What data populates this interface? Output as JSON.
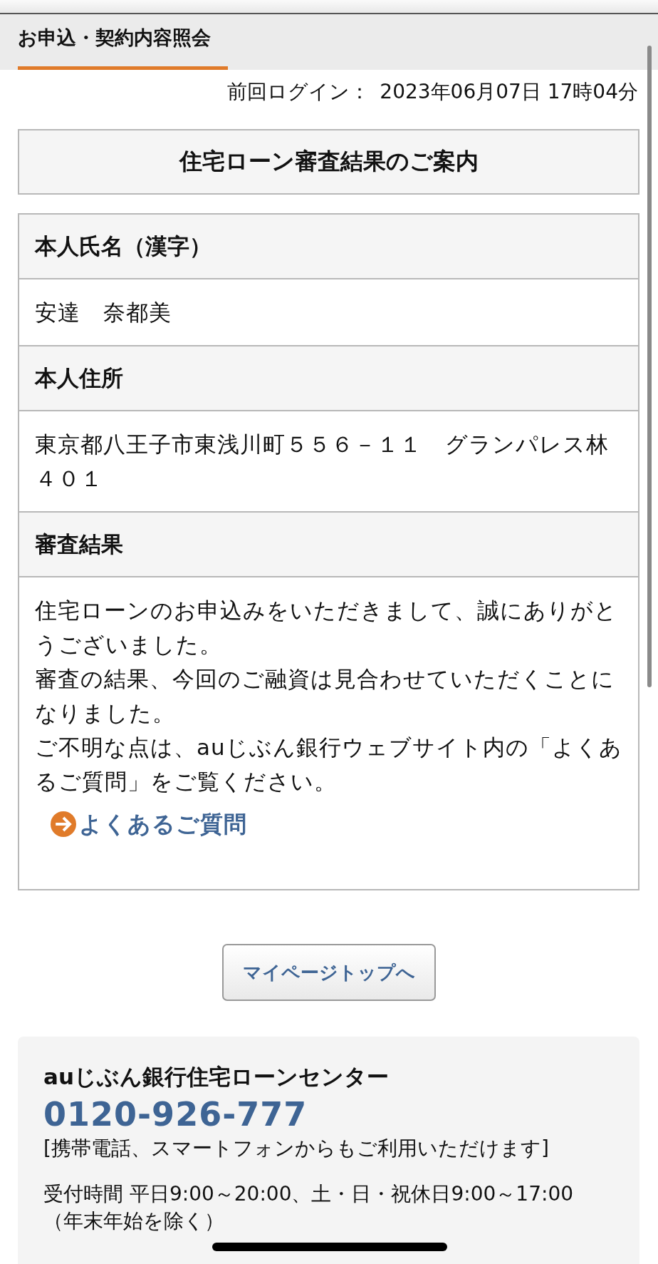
{
  "tabs": [
    {
      "label": "お申込・契約内容照会",
      "selected": true
    }
  ],
  "last_login": {
    "label": "前回ログイン：",
    "value": "2023年06月07日 17時04分"
  },
  "title": "住宅ローン審査結果のご案内",
  "fields": [
    {
      "label": "本人氏名（漢字）",
      "value": "安達　奈都美"
    },
    {
      "label": "本人住所",
      "value": "東京都八王子市東浅川町５５６－１１　グランパレス林４０１"
    },
    {
      "label": "審査結果",
      "paragraphs": [
        "住宅ローンのお申込みをいただきまして、誠にありがとうございました。",
        "審査の結果、今回のご融資は見合わせていただくことになりました。",
        "ご不明な点は、auじぶん銀行ウェブサイト内の「よくあるご質問」をご覧ください。"
      ],
      "link": "よくあるご質問"
    }
  ],
  "button": "マイページトップへ",
  "contact": {
    "name": "auじぶん銀行住宅ローンセンター",
    "phone": "0120-926-777",
    "note": "[携帯電話、スマートフォンからもご利用いただけます]",
    "hours": "受付時間 平日9:00～20:00、土・日・祝休日9:00～17:00",
    "hours_note": "（年末年始を除く）"
  }
}
